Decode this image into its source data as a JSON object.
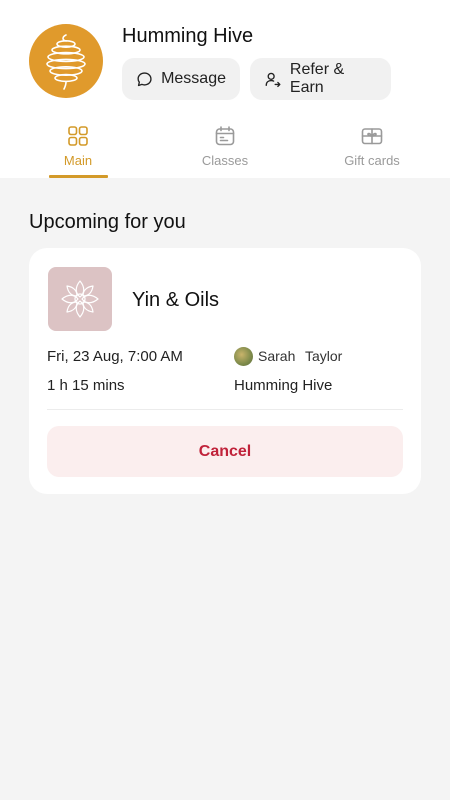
{
  "studio": {
    "name": "Humming Hive",
    "brand_color": "#e09a2c"
  },
  "actions": {
    "message_label": "Message",
    "refer_label": "Refer & Earn"
  },
  "tabs": [
    {
      "label": "Main",
      "icon": "grid-icon",
      "active": true
    },
    {
      "label": "Classes",
      "icon": "calendar-icon",
      "active": false
    },
    {
      "label": "Gift cards",
      "icon": "gift-card-icon",
      "active": false
    }
  ],
  "accent_color": "#d39a29",
  "upcoming": {
    "title": "Upcoming for you",
    "booking": {
      "class_name": "Yin & Oils",
      "date_time": "Fri, 23 Aug, 7:00 AM",
      "duration": "1 h 15 mins",
      "instructor": "Sarah Taylor",
      "venue": "Humming Hive",
      "cancel_label": "Cancel",
      "cancel_color": "#c0223a"
    }
  }
}
